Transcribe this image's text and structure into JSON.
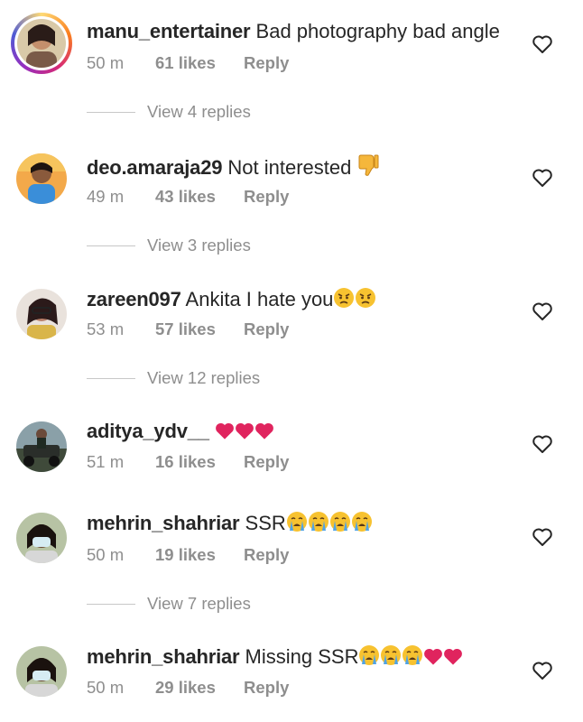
{
  "comments": [
    {
      "username": "manu_entertainer",
      "text": "Bad photography bad angle",
      "emoji": [],
      "time": "50 m",
      "likes": "61 likes",
      "reply": "Reply",
      "view_replies": "View 4 replies"
    },
    {
      "username": "deo.amaraja29",
      "text": "Not interested",
      "emoji": [
        "thumbs-down"
      ],
      "time": "49 m",
      "likes": "43 likes",
      "reply": "Reply",
      "view_replies": "View 3 replies"
    },
    {
      "username": "zareen097",
      "text": "Ankita I hate you",
      "emoji": [
        "angry",
        "angry"
      ],
      "time": "53 m",
      "likes": "57 likes",
      "reply": "Reply",
      "view_replies": "View 12 replies"
    },
    {
      "username": "aditya_ydv__",
      "text": "",
      "emoji": [
        "heart",
        "heart",
        "heart"
      ],
      "time": "51 m",
      "likes": "16 likes",
      "reply": "Reply",
      "view_replies": ""
    },
    {
      "username": "mehrin_shahriar",
      "text": "SSR",
      "emoji": [
        "crying",
        "crying",
        "crying",
        "crying"
      ],
      "time": "50 m",
      "likes": "19 likes",
      "reply": "Reply",
      "view_replies": "View 7 replies"
    },
    {
      "username": "mehrin_shahriar",
      "text": "Missing SSR",
      "emoji": [
        "crying",
        "crying",
        "crying",
        "heart",
        "heart"
      ],
      "time": "50 m",
      "likes": "29 likes",
      "reply": "Reply",
      "view_replies": ""
    }
  ],
  "colors": {
    "text": "#262626",
    "muted": "#8e8e8e",
    "heart_emoji": "#e0245e"
  }
}
